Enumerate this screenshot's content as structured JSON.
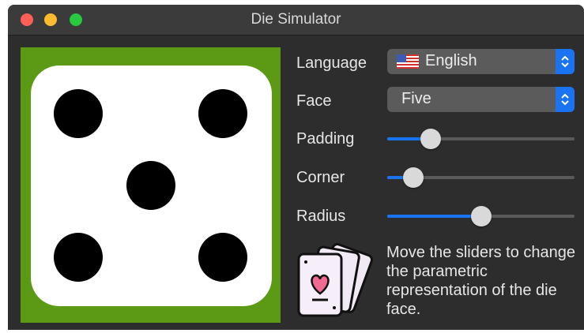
{
  "window": {
    "title": "Die Simulator"
  },
  "die": {
    "face_value": 5,
    "background_color": "#5c9a15",
    "face_color": "#ffffff",
    "pip_color": "#000000"
  },
  "controls": {
    "language": {
      "label": "Language",
      "value": "English",
      "flag": "us-flag-icon"
    },
    "face": {
      "label": "Face",
      "value": "Five"
    },
    "padding": {
      "label": "Padding",
      "value_fraction": 0.23
    },
    "corner": {
      "label": "Corner",
      "value_fraction": 0.14
    },
    "radius": {
      "label": "Radius",
      "value_fraction": 0.5
    }
  },
  "info": {
    "icon": "playing-cards-icon",
    "text": "Move the sliders to change the parametric representation of the die face."
  },
  "colors": {
    "accent": "#1a74f2",
    "window_bg": "#2d2d2d"
  }
}
